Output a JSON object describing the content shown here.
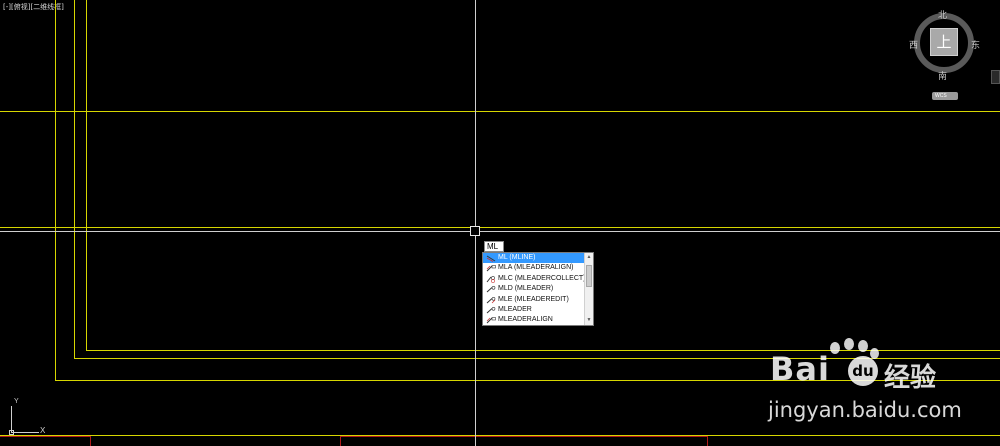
{
  "viewport": {
    "label": "[-][俯视][二维线框]"
  },
  "command_line": {
    "input_value": "ML"
  },
  "autocomplete": {
    "items": [
      {
        "label": "ML (MLINE)",
        "icon": "mline-icon",
        "selected": true
      },
      {
        "label": "MLA (MLEADERALIGN)",
        "icon": "mleader-align-icon",
        "selected": false
      },
      {
        "label": "MLC (MLEADERCOLLECT)",
        "icon": "mleader-collect-icon",
        "selected": false
      },
      {
        "label": "MLD (MLEADER)",
        "icon": "mleader-icon",
        "selected": false
      },
      {
        "label": "MLE (MLEADEREDIT)",
        "icon": "mleader-edit-icon",
        "selected": false
      },
      {
        "label": "MLEADER",
        "icon": "mleader-icon",
        "selected": false
      },
      {
        "label": "MLEADERALIGN",
        "icon": "mleader-align-icon",
        "selected": false
      }
    ]
  },
  "viewcube": {
    "north": "北",
    "south": "南",
    "west": "西",
    "east": "东",
    "face": "上",
    "wcs_label": "WCS"
  },
  "ucs": {
    "x_label": "X",
    "y_label": "Y"
  },
  "watermark": {
    "brand": "Bai",
    "du_glyph": "du",
    "cn": "经验",
    "url": "jingyan.baidu.com"
  },
  "colors": {
    "background": "#000000",
    "drawing_lines": "#d6d600",
    "crosshair": "#cfcfcf",
    "selection": "#3399ff",
    "red_lines": "#b11a1a"
  }
}
